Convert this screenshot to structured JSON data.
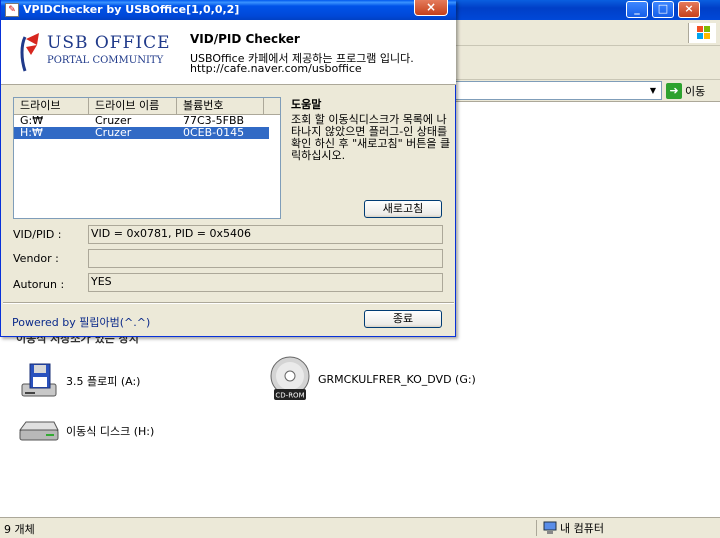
{
  "explorer": {
    "address_go_label": "이동",
    "group_header": "이동식 저장소가 있는 장치",
    "drives": [
      {
        "label": "3.5 플로피 (A:)",
        "icon": "floppy-drive-icon"
      },
      {
        "label": "GRMCKULFRER_KO_DVD (G:)",
        "icon": "cd-rom-icon",
        "badge": "CD-ROM"
      },
      {
        "label": "이동식 디스크 (H:)",
        "icon": "removable-disk-icon"
      }
    ],
    "status_count": "9 개체",
    "status_location": "내 컴퓨터",
    "window_controls": [
      "_",
      "□",
      "×"
    ]
  },
  "dialog": {
    "title": "VPIDChecker by USBOffice[1,0,0,2]",
    "close_glyph": "×",
    "logo": {
      "line1": "USB OFFICE",
      "line2": "PORTAL COMMUNITY"
    },
    "app_name": "VID/PID Checker",
    "app_desc": "USBOffice 카페에서 제공하는 프로그램 입니다.",
    "app_url": "http://cafe.naver.com/usboffice",
    "list": {
      "columns": [
        "드라이브",
        "드라이브 이름",
        "볼륨번호"
      ],
      "rows": [
        [
          "G:₩",
          "Cruzer",
          "77C3-5FBB"
        ],
        [
          "H:₩",
          "Cruzer",
          "0CEB-0145"
        ]
      ],
      "selected_index": 1
    },
    "help_title": "도움말",
    "help_text": "조회 할 이동식디스크가 목록에 나타나지 않았으면 플러그-인 상태를 확인 하신 후 \"새로고침\" 버튼을 클릭하십시오.",
    "refresh_label": "새로고침",
    "fields": {
      "vidpid_label": "VID/PID :",
      "vidpid_value": "VID = 0x0781, PID = 0x5406",
      "vendor_label": "Vendor :",
      "vendor_value": "",
      "autorun_label": "Autorun :",
      "autorun_value": "YES"
    },
    "powered_by": "Powered by 필립아범(^.^)",
    "close_label": "종료"
  }
}
